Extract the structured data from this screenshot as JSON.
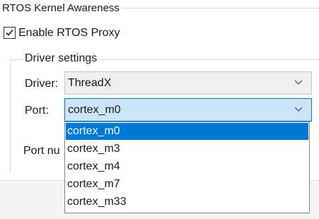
{
  "group": {
    "title": "RTOS Kernel Awareness"
  },
  "enable_proxy": {
    "label": "Enable RTOS Proxy",
    "checked": true
  },
  "driver_settings": {
    "title": "Driver settings",
    "driver": {
      "label": "Driver:",
      "value": "ThreadX"
    },
    "port": {
      "label": "Port:",
      "value": "cortex_m0"
    },
    "port_number": {
      "label": "Port nu"
    }
  },
  "port_options": [
    "cortex_m0",
    "cortex_m3",
    "cortex_m4",
    "cortex_m7",
    "cortex_m33"
  ],
  "selected_option_index": 0,
  "icons": {
    "check": "check-icon",
    "dropdown": "chevron-down-icon"
  },
  "colors": {
    "selection": "#0078d7",
    "focus_combo": "#cce4f7",
    "border": "#dcdcdc"
  }
}
